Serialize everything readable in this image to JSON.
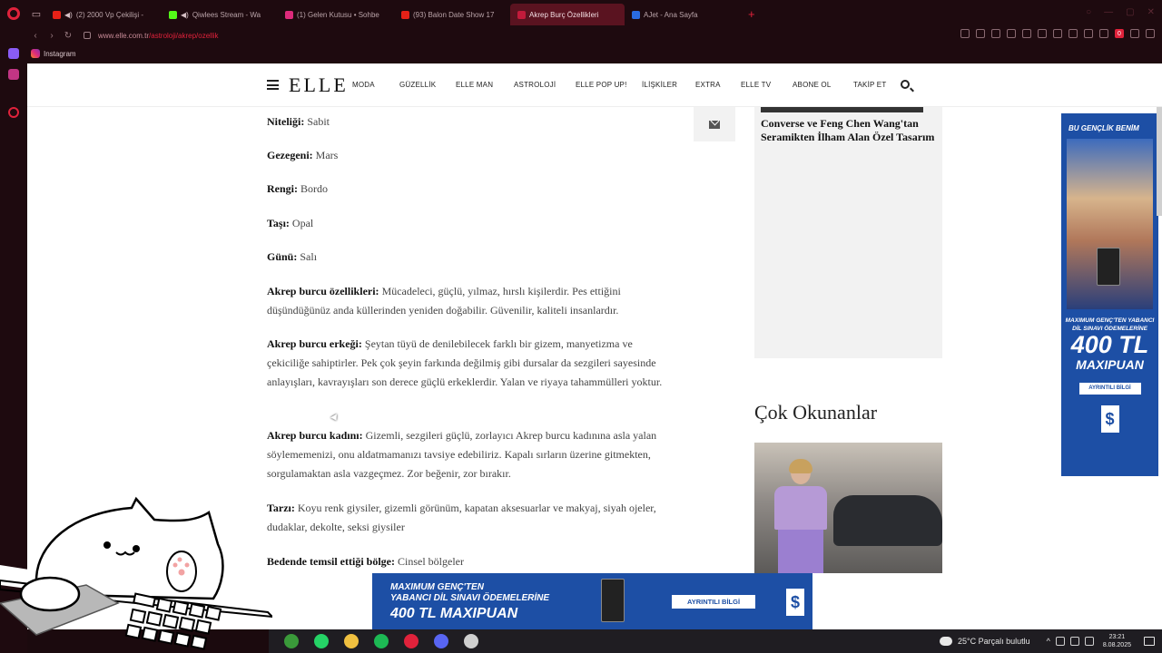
{
  "browser": {
    "tabs": [
      {
        "label": "(2) 2000 Vp Çekilişi -",
        "favicon_color": "#e62117",
        "audio": true
      },
      {
        "label": "Qiwlees Stream - Wa",
        "favicon_color": "#53fc18",
        "audio": true
      },
      {
        "label": "(1) Gelen Kutusu • Sohbe",
        "favicon_color": "#dd2a7b",
        "audio": false
      },
      {
        "label": "(93) Balon Date Show 17",
        "favicon_color": "#e62117",
        "audio": false
      },
      {
        "label": "Akrep Burç Özellikleri",
        "favicon_color": "#c21b3b",
        "audio": false,
        "active": true
      },
      {
        "label": "AJet - Ana Sayfa",
        "favicon_color": "#2a6be0",
        "audio": false
      }
    ],
    "url_host": "www.elle.com.tr",
    "url_path": "/astroloji/akrep/ozellik",
    "bookmark_label": "Instagram",
    "extension_badge": "0",
    "accent_color": "#e0223b"
  },
  "header": {
    "logo": "ELLE",
    "menu": [
      "MODA",
      "GÜZELLİK",
      "ELLE MAN",
      "ASTROLOJİ",
      "ELLE POP UP!",
      "İLİŞKİLER",
      "EXTRA",
      "ELLE TV",
      "ABONE OL",
      "TAKİP ET"
    ]
  },
  "article": {
    "items": [
      {
        "label": "Niteliği:",
        "text": "Sabit"
      },
      {
        "label": "Gezegeni:",
        "text": "Mars"
      },
      {
        "label": "Rengi:",
        "text": "Bordo"
      },
      {
        "label": "Taşı:",
        "text": "Opal"
      },
      {
        "label": "Günü:",
        "text": "Salı"
      },
      {
        "label": "Akrep burcu özellikleri:",
        "text": "Mücadeleci, güçlü, yılmaz, hırslı kişilerdir. Pes ettiğini düşündüğünüz anda küllerinden yeniden doğabilir. Güvenilir, kaliteli insanlardır."
      },
      {
        "label": "Akrep burcu erkeği:",
        "text": "Şeytan tüyü de denilebilecek farklı bir gizem, manyetizma ve çekiciliğe sahiptirler. Pek çok şeyin farkında değilmiş gibi dursalar da sezgileri sayesinde anlayışları, kavrayışları son derece güçlü erkeklerdir. Yalan ve riyaya tahammülleri yoktur."
      },
      {
        "label": "Akrep burcu kadını:",
        "text": "Gizemli, sezgileri güçlü, zorlayıcı Akrep burcu kadınına asla yalan söylememenizi, onu aldatmamanızı tavsiye edebiliriz. Kapalı sırların üzerine gitmekten, sorgulamaktan asla vazgeçmez. Zor beğenir, zor bırakır."
      },
      {
        "label": "Tarzı:",
        "text": "Koyu renk giysiler, gizemli görünüm, kapatan aksesuarlar ve makyaj, siyah ojeler, dudaklar, dekolte, seksi giysiler"
      },
      {
        "label": "Bedende temsil ettiği bölge:",
        "text": "Cinsel bölgeler"
      }
    ]
  },
  "sidebar_card": {
    "title": "Converse ve Feng Chen Wang'tan Seramikten İlham Alan Özel Tasarım"
  },
  "popular": {
    "heading": "Çok Okunanlar"
  },
  "right_ad": {
    "headline": "BU GENÇLİK BENİM",
    "sub": "MAXIMUM GENÇ'TEN YABANCI DİL SINAVI ÖDEMELERİNE",
    "amount": "400 TL",
    "unit": "MAXIPUAN",
    "button": "AYRINTILI BİLGİ",
    "logo": "$",
    "color": "#1d4fa5"
  },
  "bottom_ad": {
    "line1": "MAXIMUM GENÇ'TEN",
    "line2": "YABANCI DİL SINAVI ÖDEMELERİNE",
    "line3": "400 TL MAXIPUAN",
    "button": "AYRINTILI BİLGİ",
    "logo": "$"
  },
  "taskbar": {
    "weather": "25°C  Parçalı bulutlu",
    "time": "23:21",
    "date": "8.08.2025",
    "apps": [
      {
        "name": "xbox-icon",
        "color": "#3a9a3a"
      },
      {
        "name": "whatsapp-icon",
        "color": "#25d366"
      },
      {
        "name": "file-explorer-icon",
        "color": "#f0c040"
      },
      {
        "name": "spotify-icon",
        "color": "#1db954"
      },
      {
        "name": "opera-icon",
        "color": "#e0223b"
      },
      {
        "name": "discord-icon",
        "color": "#5865f2"
      },
      {
        "name": "obs-icon",
        "color": "#cfcfcf"
      }
    ]
  }
}
